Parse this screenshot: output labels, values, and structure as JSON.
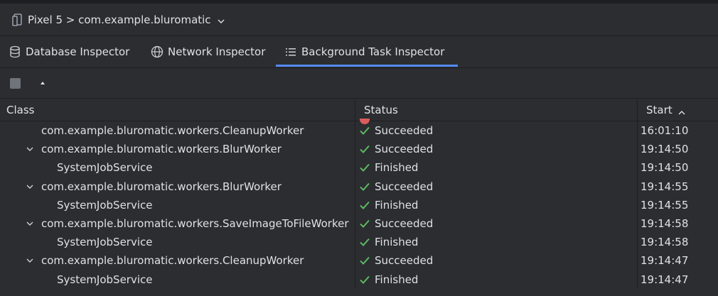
{
  "device": {
    "label": "Pixel 5 > com.example.bluromatic",
    "icon": "device-phone-icon"
  },
  "tabs": [
    {
      "label": "Database Inspector",
      "icon": "database-icon",
      "active": false
    },
    {
      "label": "Network Inspector",
      "icon": "globe-icon",
      "active": false
    },
    {
      "label": "Background Task Inspector",
      "icon": "list-icon",
      "active": true
    }
  ],
  "table": {
    "columns": [
      "Class",
      "Status",
      "Start"
    ],
    "rows": [
      {
        "kind": "worker",
        "expandable": false,
        "class": "com.example.bluromatic.workers.CleanupWorker",
        "status": "Succeeded",
        "start": "16:01:10"
      },
      {
        "kind": "worker",
        "expandable": true,
        "class": "com.example.bluromatic.workers.BlurWorker",
        "status": "Succeeded",
        "start": "19:14:50"
      },
      {
        "kind": "child",
        "expandable": false,
        "class": "SystemJobService",
        "status": "Finished",
        "start": "19:14:50"
      },
      {
        "kind": "worker",
        "expandable": true,
        "class": "com.example.bluromatic.workers.BlurWorker",
        "status": "Succeeded",
        "start": "19:14:55"
      },
      {
        "kind": "child",
        "expandable": false,
        "class": "SystemJobService",
        "status": "Finished",
        "start": "19:14:55"
      },
      {
        "kind": "worker",
        "expandable": true,
        "class": "com.example.bluromatic.workers.SaveImageToFileWorker",
        "status": "Succeeded",
        "start": "19:14:58"
      },
      {
        "kind": "child",
        "expandable": false,
        "class": "SystemJobService",
        "status": "Finished",
        "start": "19:14:58"
      },
      {
        "kind": "worker",
        "expandable": true,
        "class": "com.example.bluromatic.workers.CleanupWorker",
        "status": "Succeeded",
        "start": "19:14:47"
      },
      {
        "kind": "child",
        "expandable": false,
        "class": "SystemJobService",
        "status": "Finished",
        "start": "19:14:47"
      }
    ]
  },
  "colors": {
    "background": "#2b2d30",
    "accent": "#548af7",
    "success": "#5fb865",
    "text": "#dfe1e5"
  }
}
